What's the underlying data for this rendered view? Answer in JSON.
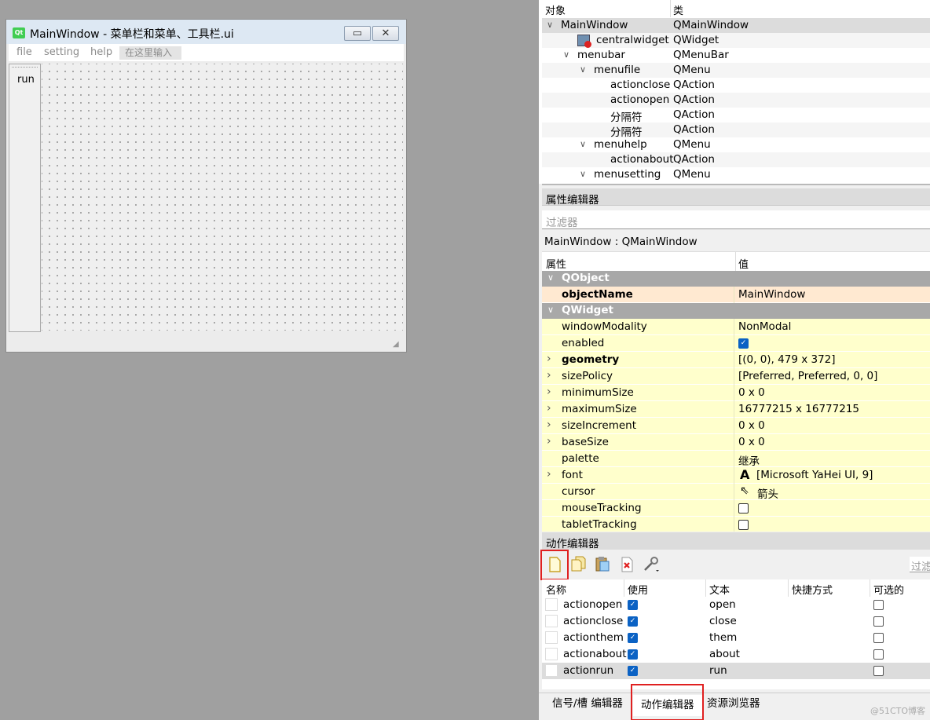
{
  "design_window": {
    "title": "MainWindow - 菜单栏和菜单、工具栏.ui",
    "qt_icon": "Qt",
    "minimize": "▭",
    "close": "✕",
    "menus": [
      "file",
      "setting",
      "help"
    ],
    "menu_input_placeholder": "在这里输入",
    "toolbar_action": "run"
  },
  "object_inspector": {
    "headers": [
      "对象",
      "类"
    ],
    "rows": [
      {
        "name": "MainWindow",
        "class": "QMainWindow",
        "level": 0,
        "expanded": true,
        "selected": true
      },
      {
        "name": "centralwidget",
        "class": "QWidget",
        "level": 1,
        "icon": "widget-icon"
      },
      {
        "name": "menubar",
        "class": "QMenuBar",
        "level": 1,
        "expanded": true
      },
      {
        "name": "menufile",
        "class": "QMenu",
        "level": 2,
        "expanded": true
      },
      {
        "name": "actionclose",
        "class": "QAction",
        "level": 3
      },
      {
        "name": "actionopen",
        "class": "QAction",
        "level": 3
      },
      {
        "name": "分隔符",
        "class": "QAction",
        "level": 3
      },
      {
        "name": "分隔符",
        "class": "QAction",
        "level": 3
      },
      {
        "name": "menuhelp",
        "class": "QMenu",
        "level": 2,
        "expanded": true
      },
      {
        "name": "actionabout",
        "class": "QAction",
        "level": 3
      },
      {
        "name": "menusetting",
        "class": "QMenu",
        "level": 2,
        "expanded": true
      }
    ]
  },
  "property_editor": {
    "title": "属性编辑器",
    "filter_placeholder": "过滤器",
    "object_label": "MainWindow : QMainWindow",
    "headers": [
      "属性",
      "值"
    ],
    "sections": [
      {
        "category": "QObject",
        "props": [
          {
            "name": "objectName",
            "value": "MainWindow",
            "bold": true
          }
        ]
      },
      {
        "category": "QWidget",
        "props": [
          {
            "name": "windowModality",
            "value": "NonModal"
          },
          {
            "name": "enabled",
            "value": "",
            "checkbox": true,
            "checked": true
          },
          {
            "name": "geometry",
            "value": "[(0, 0), 479 x 372]",
            "bold": true,
            "expandable": true
          },
          {
            "name": "sizePolicy",
            "value": "[Preferred, Preferred, 0, 0]",
            "expandable": true
          },
          {
            "name": "minimumSize",
            "value": "0 x 0",
            "expandable": true
          },
          {
            "name": "maximumSize",
            "value": "16777215 x 16777215",
            "expandable": true
          },
          {
            "name": "sizeIncrement",
            "value": "0 x 0",
            "expandable": true
          },
          {
            "name": "baseSize",
            "value": "0 x 0",
            "expandable": true
          },
          {
            "name": "palette",
            "value": "继承"
          },
          {
            "name": "font",
            "value": "[Microsoft YaHei UI, 9]",
            "expandable": true,
            "icon": "font-icon"
          },
          {
            "name": "cursor",
            "value": "箭头",
            "icon": "cursor-icon"
          },
          {
            "name": "mouseTracking",
            "value": "",
            "checkbox": true,
            "checked": false
          },
          {
            "name": "tabletTracking",
            "value": "",
            "checkbox": true,
            "checked": false
          }
        ]
      }
    ]
  },
  "action_editor": {
    "title": "动作编辑器",
    "filter_placeholder": "过滤",
    "toolbar_icons": [
      "new-action-icon",
      "copy-action-icon",
      "paste-action-icon",
      "delete-action-icon",
      "configure-icon"
    ],
    "headers": [
      "名称",
      "使用",
      "文本",
      "快捷方式",
      "可选的"
    ],
    "rows": [
      {
        "name": "actionopen",
        "used": true,
        "text": "open",
        "shortcut": "",
        "checkable": false
      },
      {
        "name": "actionclose",
        "used": true,
        "text": "close",
        "shortcut": "",
        "checkable": false
      },
      {
        "name": "actionthem",
        "used": true,
        "text": "them",
        "shortcut": "",
        "checkable": false
      },
      {
        "name": "actionabout",
        "used": true,
        "text": "about",
        "shortcut": "",
        "checkable": false
      },
      {
        "name": "actionrun",
        "used": true,
        "text": "run",
        "shortcut": "",
        "checkable": false,
        "selected": true
      }
    ]
  },
  "bottom_tabs": [
    "信号/槽 编辑器",
    "动作编辑器",
    "资源浏览器"
  ],
  "watermark": "@51CTO博客",
  "colors": {
    "highlight_red": "#e02020",
    "checkbox_blue": "#0b62c4",
    "category_gray": "#a8a8a8",
    "property_yellow": "#ffffcc"
  }
}
